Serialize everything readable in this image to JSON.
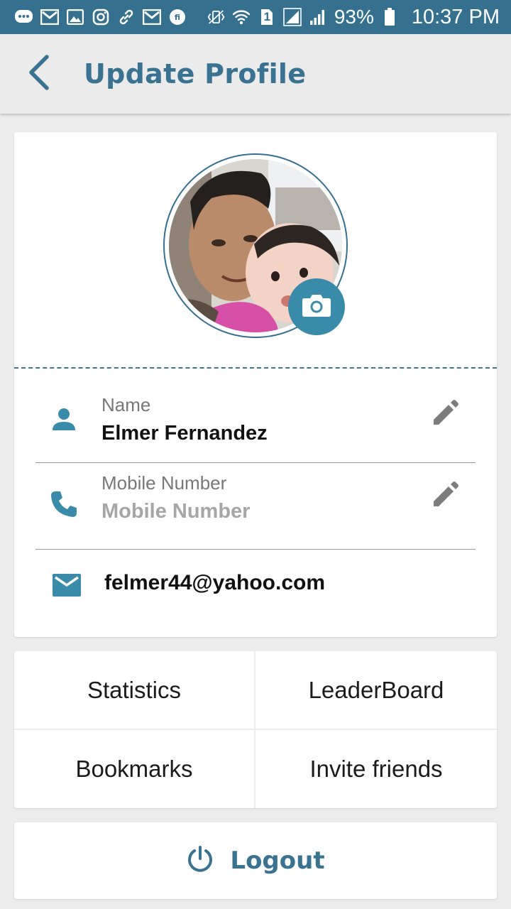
{
  "status_bar": {
    "battery": "93%",
    "time": "10:37 PM",
    "sim_slot": "1",
    "icons": [
      "messaging-icon",
      "gmail-icon",
      "gallery-icon",
      "instagram-icon",
      "link-icon",
      "gmail-icon",
      "fi-icon",
      "vibrate-icon",
      "wifi-icon",
      "sim-icon",
      "signal-icon",
      "signal-icon",
      "battery-icon"
    ]
  },
  "app_bar": {
    "title": "Update Profile",
    "back_icon": "chevron-left-icon"
  },
  "profile": {
    "camera_icon": "camera-icon",
    "name": {
      "label": "Name",
      "value": "Elmer Fernandez",
      "icon": "person-icon",
      "edit_icon": "pencil-icon"
    },
    "mobile": {
      "label": "Mobile Number",
      "value": "Mobile Number",
      "icon": "phone-icon",
      "edit_icon": "pencil-icon"
    },
    "email": {
      "value": "felmer44@yahoo.com",
      "icon": "mail-icon"
    }
  },
  "menu": {
    "items": [
      {
        "label": "Statistics"
      },
      {
        "label": "LeaderBoard"
      },
      {
        "label": "Bookmarks"
      },
      {
        "label": "Invite friends"
      }
    ]
  },
  "logout": {
    "label": "Logout",
    "icon": "power-icon"
  },
  "colors": {
    "status_bar": "#35718f",
    "accent": "#3a7391",
    "icon_blue": "#3a8aaa",
    "background": "#ececec"
  }
}
